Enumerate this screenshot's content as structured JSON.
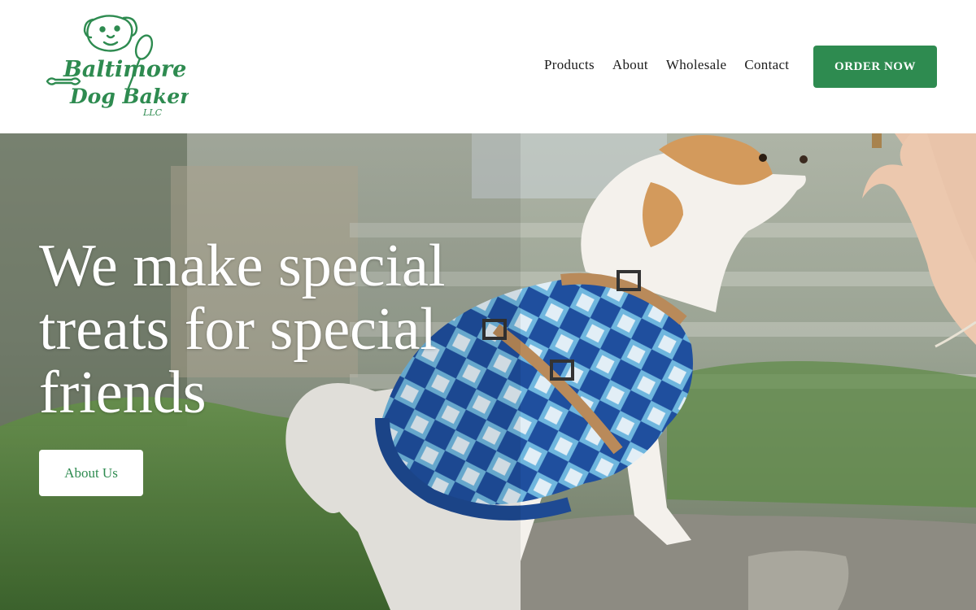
{
  "logo": {
    "line1": "Baltimore",
    "line2": "Dog Bakery",
    "suffix": "LLC",
    "color": "#2e8b50"
  },
  "nav": {
    "items": [
      "Products",
      "About",
      "Wholesale",
      "Contact"
    ],
    "cta": "ORDER NOW"
  },
  "hero": {
    "title": "We make special treats for special friends",
    "button": "About Us"
  },
  "colors": {
    "brand_green": "#2e8b50",
    "white": "#ffffff"
  }
}
